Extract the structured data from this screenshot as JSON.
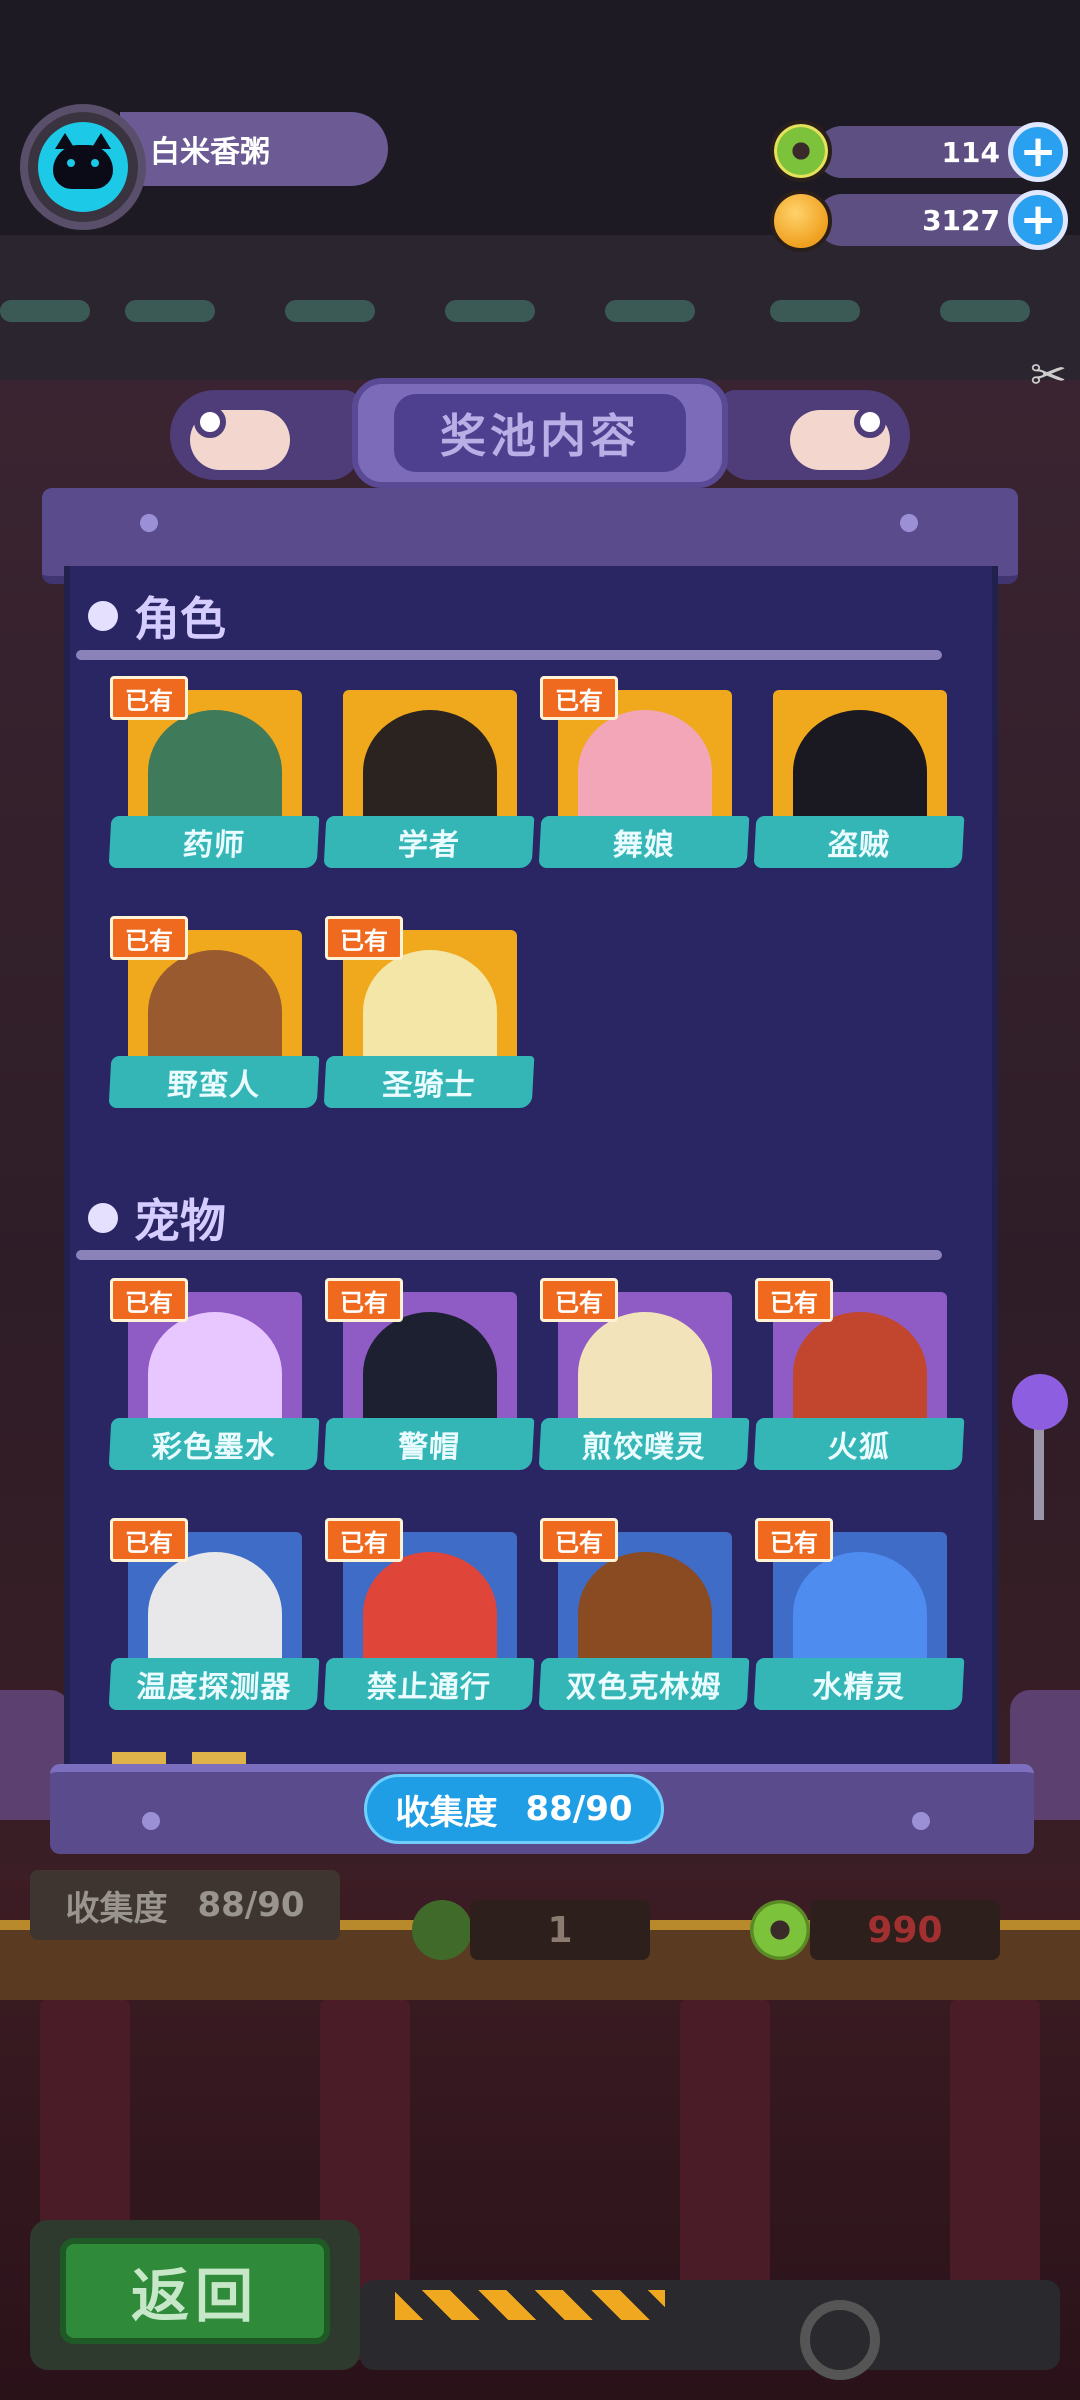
{
  "header": {
    "username": "白米香粥",
    "avatar_icon": "cat-face-icon",
    "currencies": [
      {
        "name": "donut",
        "icon": "donut-coin-icon",
        "value": "114"
      },
      {
        "name": "planet",
        "icon": "planet-coin-icon",
        "value": "3127"
      }
    ]
  },
  "panel": {
    "title": "奖池内容",
    "sections": [
      {
        "title": "角色",
        "items": [
          {
            "label": "药师",
            "owned": true,
            "badge": "已有",
            "frame": "gold",
            "art_color": "#3f7a5a"
          },
          {
            "label": "学者",
            "owned": false,
            "badge": "",
            "frame": "gold",
            "art_color": "#2a2320"
          },
          {
            "label": "舞娘",
            "owned": true,
            "badge": "已有",
            "frame": "gold",
            "art_color": "#f2a6b8"
          },
          {
            "label": "盗贼",
            "owned": false,
            "badge": "",
            "frame": "gold",
            "art_color": "#1a1820"
          },
          {
            "label": "野蛮人",
            "owned": true,
            "badge": "已有",
            "frame": "gold",
            "art_color": "#9a5a30"
          },
          {
            "label": "圣骑士",
            "owned": true,
            "badge": "已有",
            "frame": "gold",
            "art_color": "#f3e6a6"
          }
        ]
      },
      {
        "title": "宠物",
        "items": [
          {
            "label": "彩色墨水",
            "owned": true,
            "badge": "已有",
            "frame": "purple",
            "art_color": "#e8c6ff"
          },
          {
            "label": "警帽",
            "owned": true,
            "badge": "已有",
            "frame": "purple",
            "art_color": "#1d2030"
          },
          {
            "label": "煎饺噗灵",
            "owned": true,
            "badge": "已有",
            "frame": "purple",
            "art_color": "#f3e3bb"
          },
          {
            "label": "火狐",
            "owned": true,
            "badge": "已有",
            "frame": "purple",
            "art_color": "#c2462e"
          },
          {
            "label": "温度探测器",
            "owned": true,
            "badge": "已有",
            "frame": "blue",
            "art_color": "#e8e8ea"
          },
          {
            "label": "禁止通行",
            "owned": true,
            "badge": "已有",
            "frame": "blue",
            "art_color": "#e0453a"
          },
          {
            "label": "双色克林姆",
            "owned": true,
            "badge": "已有",
            "frame": "blue",
            "art_color": "#8a4a22"
          },
          {
            "label": "水精灵",
            "owned": true,
            "badge": "已有",
            "frame": "blue",
            "art_color": "#4f8cf0"
          }
        ]
      }
    ],
    "collection": {
      "label": "收集度",
      "value": "88/90"
    }
  },
  "background": {
    "collection_label": "收集度",
    "collection_value": "88/90",
    "slot_left_value": "1",
    "slot_right_value": "990"
  },
  "footer": {
    "back_label": "返回"
  },
  "colors": {
    "panel": "#2a2563",
    "label_teal": "#35b6b6",
    "badge_orange": "#ef6a1e",
    "accent_blue": "#1f9ee6"
  }
}
